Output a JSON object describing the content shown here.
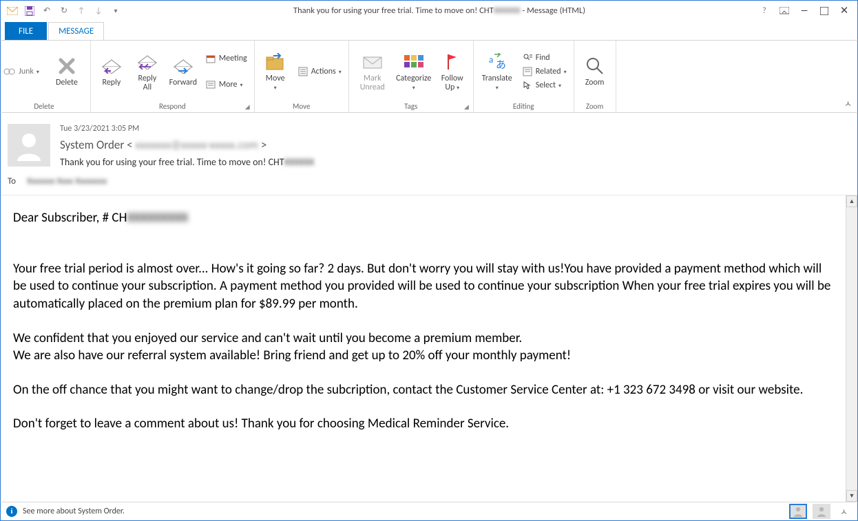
{
  "titlebar": {
    "title_prefix": "Thank you for using your free trial. Time to move on! CHT",
    "title_blur": "XXXXXX",
    "title_suffix": " - Message (HTML)"
  },
  "tabs": {
    "file": "FILE",
    "message": "MESSAGE"
  },
  "ribbon": {
    "junk": "Junk",
    "delete": {
      "btn": "Delete",
      "group": "Delete"
    },
    "respond": {
      "reply": "Reply",
      "replyall": "Reply\nAll",
      "forward": "Forward",
      "meeting": "Meeting",
      "more": "More",
      "group": "Respond"
    },
    "move_group": {
      "move": "Move",
      "actions": "Actions",
      "group": "Move"
    },
    "tags": {
      "mark": "Mark\nUnread",
      "categorize": "Categorize",
      "followup": "Follow\nUp",
      "group": "Tags"
    },
    "editing": {
      "translate": "Translate",
      "find": "Find",
      "related": "Related",
      "select": "Select",
      "group": "Editing"
    },
    "zoom": {
      "zoom": "Zoom",
      "group": "Zoom"
    }
  },
  "header": {
    "date": "Tue 3/23/2021 3:05 PM",
    "from_name": "System Order",
    "from_open": " < ",
    "from_blur": "xxxxxxx@xxxxx-xxxxx.com",
    "from_close": " >",
    "subject_prefix": "Thank you for using your free trial. Time to move on! CHT",
    "subject_blur": "XXXXXX",
    "to_label": "To",
    "to_blur": "Xxxxxxx Xxxx Xxxxxxxx"
  },
  "body": {
    "greeting_prefix": "Dear Subscriber, # CH",
    "greeting_blur": "XXXXXXXXX",
    "p1": "Your free trial period is almost over... How's it going so far? 2 days. But don't worry you will stay with us!You have provided a payment method which will be used to continue your subscription. A payment method you provided will be used to continue your subscription When your free trial expires you will be automatically placed on the premium plan for $89.99 per month.",
    "p2": " We confident that you enjoyed our service and can't wait until you become a premium member.",
    "p3": "We are also have our referral system available! Bring friend and get up to 20% off your monthly payment!",
    "p4": "On the off chance that you might want to change/drop the subcription, contact the Customer Service Center at: +1 323 672 3498 or visit our website.",
    "p5": "Don't forget to leave a comment about us! Thank you for choosing Medical Reminder Service."
  },
  "footer": {
    "info": "See more about System Order."
  }
}
